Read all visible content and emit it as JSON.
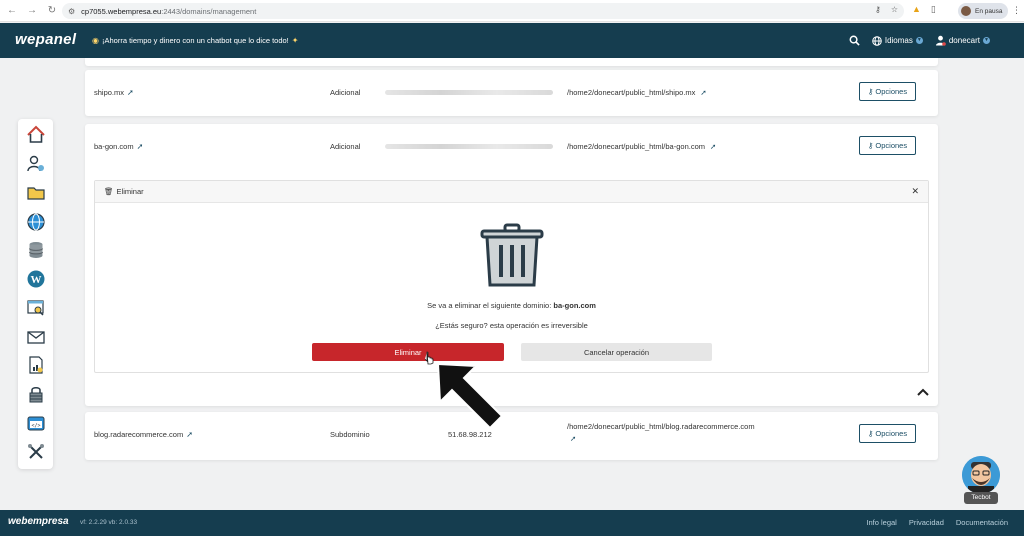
{
  "browser": {
    "url_host": "cp7055.webempresa.eu",
    "url_path": ":2443/domains/management",
    "profile_status": "En pausa"
  },
  "header": {
    "logo": "wepanel",
    "promo_text": "¡Ahorra tiempo y dinero con un chatbot que lo dice todo!",
    "languages_label": "Idiomas",
    "user_label": "donecart"
  },
  "domains": [
    {
      "name": "shipo.mx",
      "type": "Adicional",
      "path": "/home2/donecart/public_html/shipo.mx",
      "options_label": "Opciones"
    },
    {
      "name": "ba-gon.com",
      "type": "Adicional",
      "path": "/home2/donecart/public_html/ba-gon.com",
      "options_label": "Opciones"
    },
    {
      "name": "blog.radarecommerce.com",
      "type": "Subdominio",
      "ip": "51.68.98.212",
      "path": "/home2/donecart/public_html/blog.radarecommerce.com",
      "options_label": "Opciones"
    }
  ],
  "delete_panel": {
    "title": "Eliminar",
    "message_prefix": "Se va a eliminar el siguiente dominio:",
    "message_domain": "ba-gon.com",
    "confirm_question": "¿Estás seguro? esta operación es irreversible",
    "delete_button": "Eliminar",
    "cancel_button": "Cancelar operación"
  },
  "chatbot": {
    "label": "Tecbot"
  },
  "footer": {
    "logo": "webempresa",
    "version": "vf: 2.2.29  vb: 2.0.33",
    "links": [
      "Info legal",
      "Privacidad",
      "Documentación"
    ]
  },
  "colors": {
    "header_bg": "#153d4f",
    "danger": "#c7262b",
    "accent": "#1d4f66"
  }
}
